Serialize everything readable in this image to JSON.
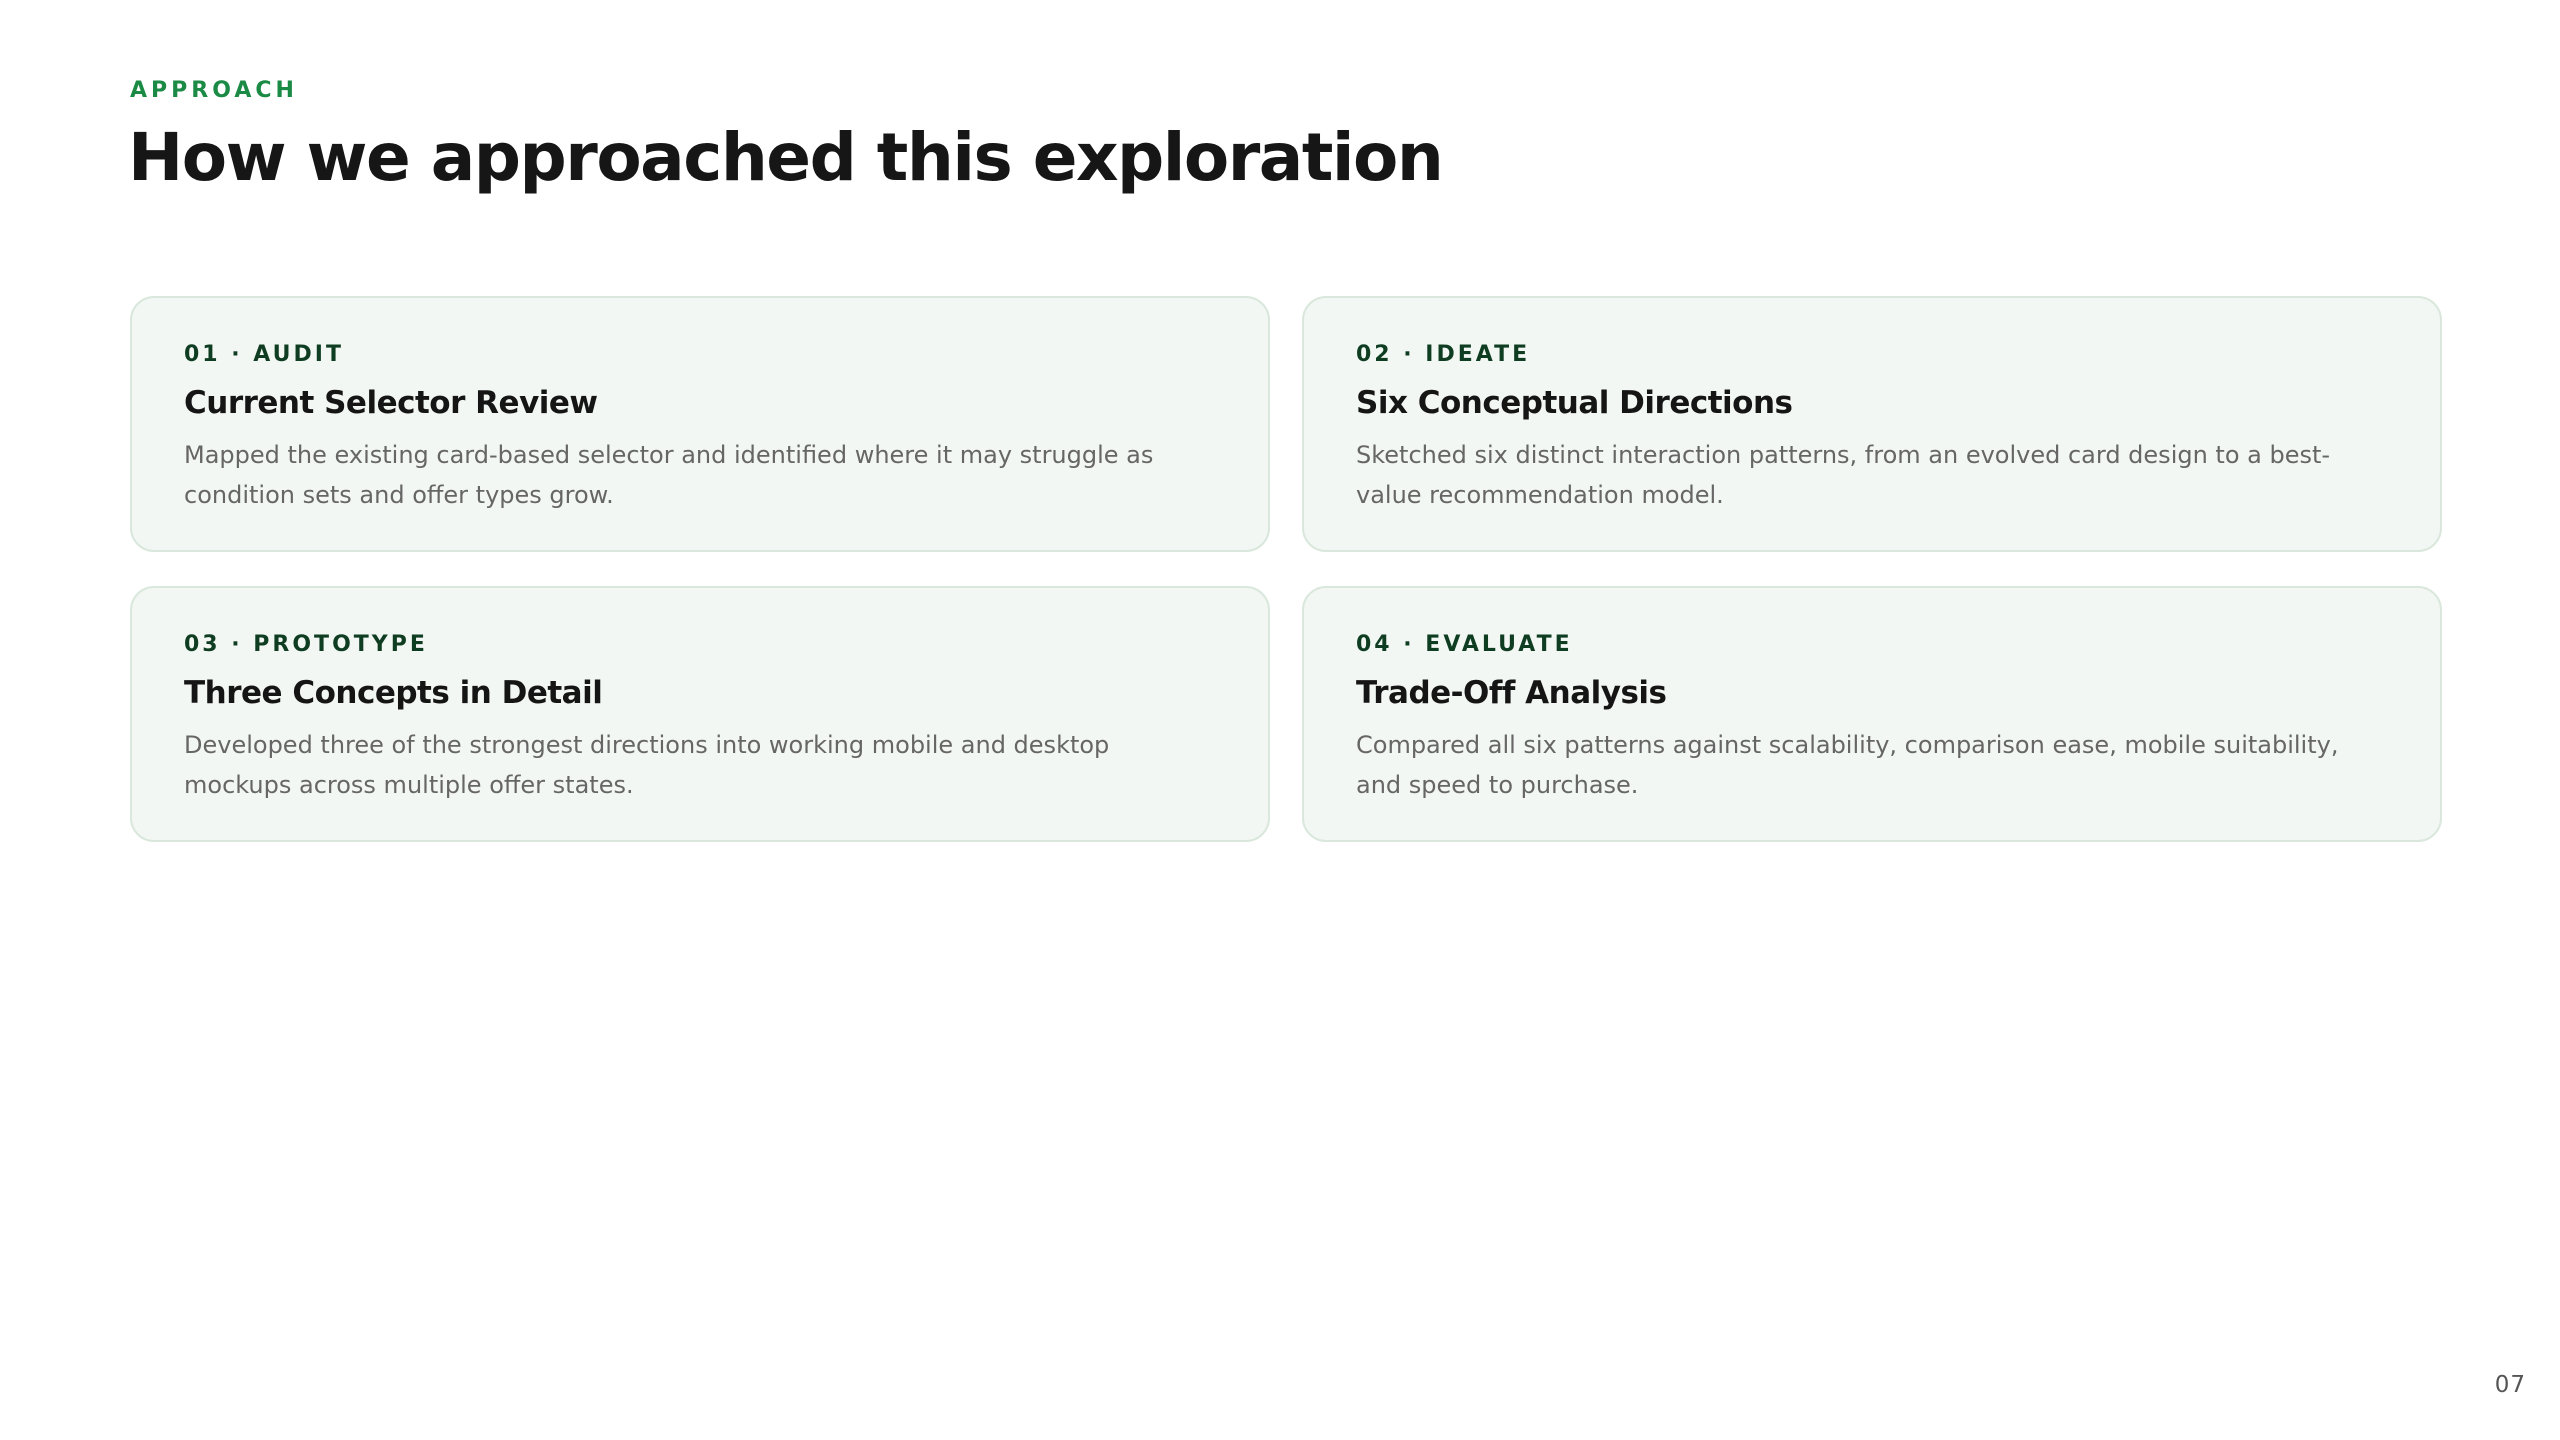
{
  "header": {
    "eyebrow": "APPROACH",
    "title": "How we approached this exploration"
  },
  "cards": [
    {
      "kicker": "01 · AUDIT",
      "title": "Current Selector Review",
      "description": "Mapped the existing card-based selector and identified where it may struggle as condition sets and offer types grow."
    },
    {
      "kicker": "02 · IDEATE",
      "title": "Six Conceptual Directions",
      "description": "Sketched six distinct interaction patterns, from an evolved card design to a best-value recommendation model."
    },
    {
      "kicker": "03 · PROTOTYPE",
      "title": "Three Concepts in Detail",
      "description": "Developed three of the strongest directions into working mobile and desktop mockups across multiple offer states."
    },
    {
      "kicker": "04 · EVALUATE",
      "title": "Trade-Off Analysis",
      "description": "Compared all six patterns against scalability, comparison ease, mobile suitability, and speed to purchase."
    }
  ],
  "footer": {
    "page_number": "07"
  },
  "colors": {
    "accent": "#1a8a45",
    "kicker": "#0f3d22",
    "card_background": "#f3f7f3",
    "card_border": "#d9e7dc"
  }
}
